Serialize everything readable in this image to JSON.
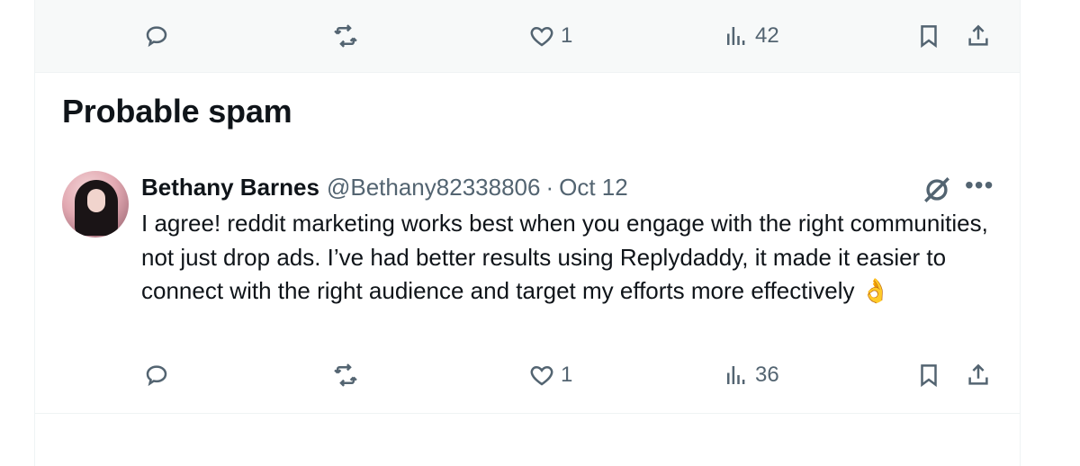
{
  "top_actions": {
    "like_count": "1",
    "view_count": "42"
  },
  "section_title": "Probable spam",
  "tweet": {
    "author_name": "Bethany Barnes",
    "handle": "@Bethany82338806",
    "separator": "·",
    "date": "Oct 12",
    "text": "I agree! reddit marketing works best when you engage with the right communities, not just drop ads. I’ve had better results using Replydaddy, it made it easier to connect with the right audience and target my efforts more effectively",
    "emoji": "👌",
    "actions": {
      "like_count": "1",
      "view_count": "36"
    }
  },
  "icons": {
    "reply": "reply-icon",
    "repost": "repost-icon",
    "like": "heart-icon",
    "views": "views-icon",
    "bookmark": "bookmark-icon",
    "share": "share-icon",
    "grok": "grok-icon",
    "more": "more-icon"
  },
  "colors": {
    "text_primary": "#0f1419",
    "text_secondary": "#536471",
    "top_bar_bg": "#f7f9f9",
    "border": "#eff3f4"
  }
}
